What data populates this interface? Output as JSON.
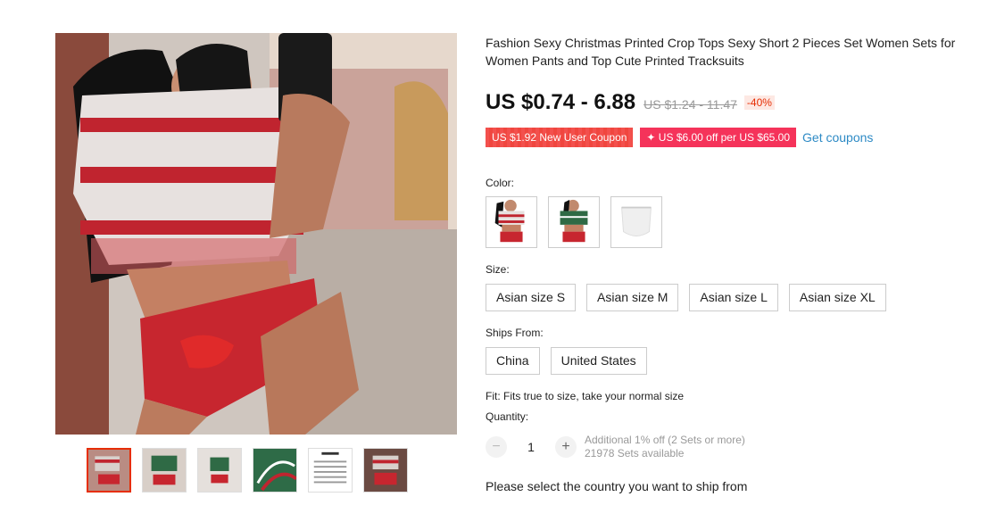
{
  "product": {
    "title": "Fashion Sexy Christmas Printed Crop Tops Sexy Short 2 Pieces Set Women Sets for Women Pants and Top Cute Printed Tracksuits",
    "price": "US $0.74 - 6.88",
    "original_price": "US $1.24 - 11.47",
    "discount": "-40%"
  },
  "coupons": {
    "new_user": "US $1.92 New User Coupon",
    "store": "✦ US $6.00 off per US $65.00",
    "get_coupons": "Get coupons"
  },
  "color": {
    "label": "Color:",
    "options": [
      "red-christmas-set",
      "green-christmas-set",
      "white-shorts"
    ]
  },
  "size": {
    "label": "Size:",
    "options": [
      "Asian size S",
      "Asian size M",
      "Asian size L",
      "Asian size XL"
    ]
  },
  "ships_from": {
    "label": "Ships From:",
    "options": [
      "China",
      "United States"
    ]
  },
  "fit": "Fit: Fits true to size, take your normal size",
  "quantity": {
    "label": "Quantity:",
    "minus": "−",
    "value": "1",
    "plus": "+",
    "additional": "Additional 1% off (2 Sets or more)",
    "available": "21978 Sets available"
  },
  "ship_message": "Please select the country you want to ship from",
  "thumbnails": [
    "red-set-front",
    "green-set-front",
    "green-set-pose",
    "green-fabric-closeup",
    "size-chart",
    "red-set-back"
  ],
  "colors": {
    "accent_red": "#e62e04",
    "coupon_red": "#f44f4a",
    "coupon_pink": "#f5335a",
    "link_blue": "#2d8ac5"
  }
}
